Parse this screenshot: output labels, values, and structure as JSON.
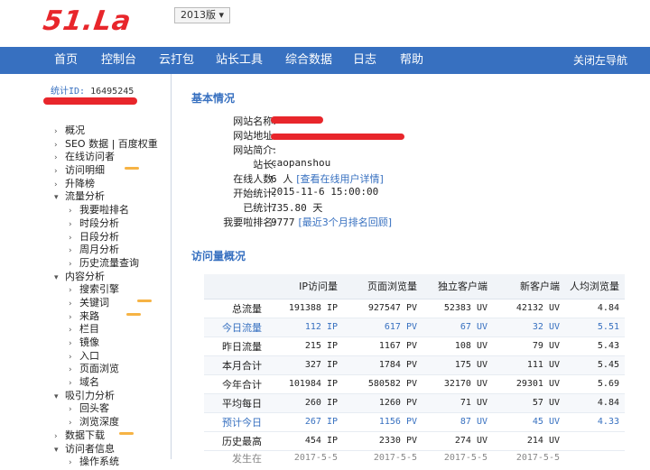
{
  "header": {
    "logo": "51.La",
    "version": "2013版 ▾"
  },
  "nav": {
    "items": [
      "首页",
      "控制台",
      "云打包",
      "站长工具",
      "综合数据",
      "日志",
      "帮助"
    ],
    "close_left": "关闭左导航"
  },
  "sidebar": {
    "stat_id_label": "统计ID:",
    "stat_id_value": "16495245",
    "tree": [
      {
        "label": "概况",
        "level": 1,
        "open": false
      },
      {
        "label": "SEO 数据 | 百度权重",
        "level": 1,
        "open": false
      },
      {
        "label": "在线访问者",
        "level": 1,
        "open": false
      },
      {
        "label": "访问明细",
        "level": 1,
        "open": false
      },
      {
        "label": "升降榜",
        "level": 1,
        "open": false
      },
      {
        "label": "流量分析",
        "level": 1,
        "open": true
      },
      {
        "label": "我要啦排名",
        "level": 2
      },
      {
        "label": "时段分析",
        "level": 2
      },
      {
        "label": "日段分析",
        "level": 2
      },
      {
        "label": "周月分析",
        "level": 2
      },
      {
        "label": "历史流量查询",
        "level": 2
      },
      {
        "label": "内容分析",
        "level": 1,
        "open": true
      },
      {
        "label": "搜索引擎",
        "level": 2
      },
      {
        "label": "关键词",
        "level": 2
      },
      {
        "label": "来路",
        "level": 2
      },
      {
        "label": "栏目",
        "level": 2
      },
      {
        "label": "镜像",
        "level": 2
      },
      {
        "label": "入口",
        "level": 2
      },
      {
        "label": "页面浏览",
        "level": 2
      },
      {
        "label": "域名",
        "level": 2
      },
      {
        "label": "吸引力分析",
        "level": 1,
        "open": true
      },
      {
        "label": "回头客",
        "level": 2
      },
      {
        "label": "浏览深度",
        "level": 2
      },
      {
        "label": "数据下载",
        "level": 1,
        "open": false
      },
      {
        "label": "访问者信息",
        "level": 1,
        "open": true
      },
      {
        "label": "操作系统",
        "level": 2
      }
    ]
  },
  "basic": {
    "title": "基本情况",
    "rows": [
      {
        "k": "网站名称:",
        "v": ""
      },
      {
        "k": "网站地址:",
        "v": ""
      },
      {
        "k": "网站简介:",
        "v": "-"
      },
      {
        "k": "站长:",
        "v": "caopanshou"
      },
      {
        "k": "在线人数:",
        "v": "6 人",
        "link": "[查看在线用户详情]"
      },
      {
        "k": "开始统计:",
        "v": "2015-11-6 15:00:00"
      },
      {
        "k": "已统计:",
        "v": "735.80 天"
      },
      {
        "k": "我要啦排名:",
        "v": "9777",
        "link": "[最近3个月排名回顾]"
      }
    ]
  },
  "overview": {
    "title": "访问量概况",
    "headers": [
      "",
      "IP访问量",
      "页面浏览量",
      "独立客户端",
      "新客户端",
      "人均浏览量"
    ],
    "rows": [
      {
        "cells": [
          "总流量",
          "191388 IP",
          "927547 PV",
          "52383 UV",
          "42132 UV",
          "4.84"
        ],
        "style": ""
      },
      {
        "cells": [
          "今日流量",
          "112 IP",
          "617 PV",
          "67 UV",
          "32 UV",
          "5.51"
        ],
        "style": "blue alt"
      },
      {
        "cells": [
          "昨日流量",
          "215 IP",
          "1167 PV",
          "108 UV",
          "79 UV",
          "5.43"
        ],
        "style": ""
      },
      {
        "cells": [
          "本月合计",
          "327 IP",
          "1784 PV",
          "175 UV",
          "111 UV",
          "5.45"
        ],
        "style": "alt"
      },
      {
        "cells": [
          "今年合计",
          "101984 IP",
          "580582 PV",
          "32170 UV",
          "29301 UV",
          "5.69"
        ],
        "style": ""
      },
      {
        "cells": [
          "平均每日",
          "260 IP",
          "1260 PV",
          "71 UV",
          "57 UV",
          "4.84"
        ],
        "style": "alt"
      },
      {
        "cells": [
          "预计今日",
          "267 IP",
          "1156 PV",
          "87 UV",
          "45 UV",
          "4.33"
        ],
        "style": "blue"
      },
      {
        "cells": [
          "历史最高",
          "454 IP",
          "2330 PV",
          "274 UV",
          "214 UV",
          ""
        ],
        "style": ""
      },
      {
        "cells": [
          "发生在",
          "2017-5-5",
          "2017-5-5",
          "2017-5-5",
          "2017-5-5",
          ""
        ],
        "style": "sub"
      }
    ]
  },
  "colors": {
    "nav_bg": "#3770c0",
    "logo": "#e8262b",
    "link": "#3770c0"
  }
}
